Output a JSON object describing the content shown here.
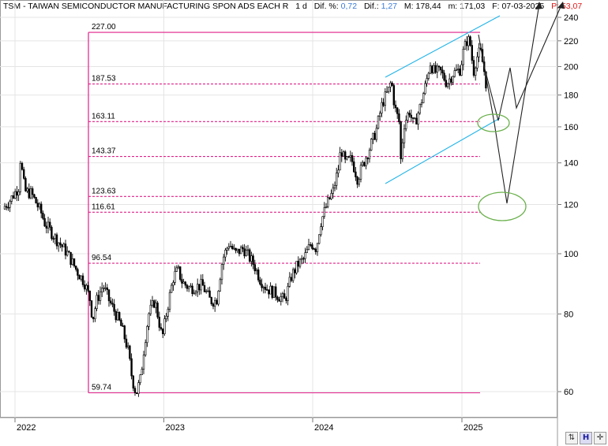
{
  "header": {
    "symbol": "TSM - TAIWAN SEMICONDUCTOR MANUFACTURING SPON ADS EACH R",
    "timeframe": "1 d",
    "dif_pct_label": "Dif. %:",
    "dif_pct_value": "0,72",
    "dif_label": "Dif.:",
    "dif_value": "1,27",
    "max_label": "M:",
    "max_value": "178,44",
    "min_label": "m:",
    "min_value": "171,03",
    "date_label": "F:",
    "date_value": "07-03-2025",
    "price_label": "P:",
    "price_value": "53,07"
  },
  "colors": {
    "fib": "#e0208a",
    "channel": "#22b4e8",
    "ellipse": "#6ab04c",
    "candles": "#000000"
  },
  "corner_buttons": [
    "chart-scale-icon",
    "h-scale-icon",
    "pan-arrows-icon"
  ],
  "chart_data": {
    "type": "candlestick",
    "y_scale": "log",
    "ylim": [
      52,
      250
    ],
    "y_ticks": [
      60,
      80,
      100,
      120,
      140,
      160,
      180,
      200,
      220,
      240
    ],
    "x_ticks": [
      "2022",
      "2023",
      "2024",
      "2025"
    ],
    "fib_levels": [
      {
        "label": "227.00",
        "value": 227.0
      },
      {
        "label": "187.53",
        "value": 187.53
      },
      {
        "label": "163.11",
        "value": 163.11
      },
      {
        "label": "143.37",
        "value": 143.37
      },
      {
        "label": "123.63",
        "value": 123.63
      },
      {
        "label": "116.61",
        "value": 116.61
      },
      {
        "label": "96.54",
        "value": 96.54
      },
      {
        "label": "59.74",
        "value": 59.74
      }
    ],
    "price_path": [
      [
        "2021-12-01",
        118
      ],
      [
        "2021-12-20",
        122
      ],
      [
        "2022-01-10",
        128
      ],
      [
        "2022-01-14",
        142
      ],
      [
        "2022-01-25",
        126
      ],
      [
        "2022-02-10",
        125
      ],
      [
        "2022-03-07",
        116
      ],
      [
        "2022-03-15",
        112
      ],
      [
        "2022-04-10",
        106
      ],
      [
        "2022-05-10",
        100
      ],
      [
        "2022-06-01",
        94
      ],
      [
        "2022-06-20",
        90
      ],
      [
        "2022-07-05",
        84
      ],
      [
        "2022-07-10",
        78
      ],
      [
        "2022-07-20",
        84
      ],
      [
        "2022-08-05",
        89
      ],
      [
        "2022-08-20",
        84
      ],
      [
        "2022-09-05",
        80
      ],
      [
        "2022-09-20",
        76
      ],
      [
        "2022-10-05",
        70
      ],
      [
        "2022-10-15",
        63
      ],
      [
        "2022-10-25",
        59.5
      ],
      [
        "2022-11-05",
        63
      ],
      [
        "2022-11-15",
        72
      ],
      [
        "2022-11-25",
        80
      ],
      [
        "2022-12-10",
        84
      ],
      [
        "2022-12-28",
        73
      ],
      [
        "2023-01-10",
        82
      ],
      [
        "2023-01-25",
        92
      ],
      [
        "2023-02-05",
        94
      ],
      [
        "2023-02-15",
        90
      ],
      [
        "2023-03-05",
        88
      ],
      [
        "2023-04-05",
        89
      ],
      [
        "2023-04-25",
        84
      ],
      [
        "2023-05-10",
        84
      ],
      [
        "2023-05-25",
        98
      ],
      [
        "2023-06-10",
        104
      ],
      [
        "2023-06-25",
        100
      ],
      [
        "2023-07-15",
        102
      ],
      [
        "2023-08-10",
        96
      ],
      [
        "2023-08-25",
        91
      ],
      [
        "2023-09-10",
        88
      ],
      [
        "2023-10-05",
        86
      ],
      [
        "2023-10-25",
        84
      ],
      [
        "2023-11-10",
        92
      ],
      [
        "2023-11-25",
        96
      ],
      [
        "2023-12-10",
        98
      ],
      [
        "2023-12-28",
        104
      ],
      [
        "2024-01-10",
        102
      ],
      [
        "2024-01-20",
        112
      ],
      [
        "2024-02-05",
        120
      ],
      [
        "2024-02-20",
        126
      ],
      [
        "2024-03-05",
        138
      ],
      [
        "2024-03-10",
        148
      ],
      [
        "2024-03-20",
        140
      ],
      [
        "2024-04-05",
        142
      ],
      [
        "2024-04-20",
        132
      ],
      [
        "2024-05-05",
        140
      ],
      [
        "2024-05-20",
        148
      ],
      [
        "2024-06-05",
        158
      ],
      [
        "2024-06-20",
        175
      ],
      [
        "2024-07-05",
        183
      ],
      [
        "2024-07-12",
        190
      ],
      [
        "2024-07-20",
        172
      ],
      [
        "2024-08-01",
        162
      ],
      [
        "2024-08-05",
        136
      ],
      [
        "2024-08-10",
        160
      ],
      [
        "2024-08-25",
        170
      ],
      [
        "2024-09-05",
        160
      ],
      [
        "2024-09-20",
        172
      ],
      [
        "2024-10-05",
        188
      ],
      [
        "2024-10-15",
        203
      ],
      [
        "2024-10-25",
        196
      ],
      [
        "2024-11-10",
        196
      ],
      [
        "2024-11-25",
        188
      ],
      [
        "2024-12-10",
        195
      ],
      [
        "2024-12-28",
        198
      ],
      [
        "2025-01-05",
        212
      ],
      [
        "2025-01-15",
        222
      ],
      [
        "2025-01-25",
        214
      ],
      [
        "2025-01-27",
        192
      ],
      [
        "2025-02-05",
        206
      ],
      [
        "2025-02-15",
        212
      ],
      [
        "2025-02-25",
        196
      ],
      [
        "2025-03-07",
        176
      ]
    ]
  }
}
